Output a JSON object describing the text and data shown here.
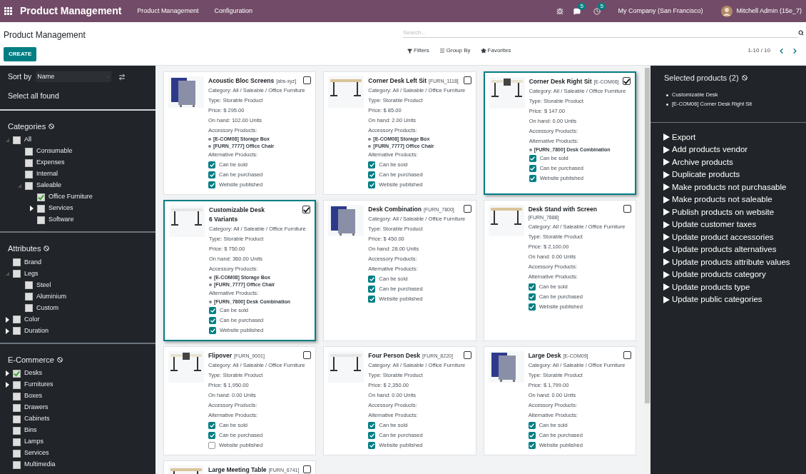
{
  "navbar": {
    "app_title": "Product Management",
    "menus": [
      "Product Management",
      "Configuration"
    ],
    "messages_badge": "5",
    "activities_badge": "5",
    "company": "My Company (San Francisco)",
    "user": "Mitchell Admin (15e_7)"
  },
  "control_panel": {
    "breadcrumb": "Product Management",
    "search": {
      "placeholder": "Search..."
    },
    "create_button": "CREATE",
    "filters": [
      {
        "kind": "filter",
        "label": "Filters"
      },
      {
        "kind": "group",
        "label": "Group By"
      },
      {
        "kind": "favorite",
        "label": "Favorites"
      }
    ],
    "pager": "1-10 / 10"
  },
  "sidebar": {
    "sort_label": "Sort by",
    "sort_value": "Name",
    "select_all": "Select all found",
    "sections": [
      {
        "title": "Categories",
        "items": [
          {
            "label": "All",
            "checked": false,
            "expanded": true,
            "children": [
              {
                "label": "Consumable",
                "checked": false
              },
              {
                "label": "Expenses",
                "checked": false
              },
              {
                "label": "Internal",
                "checked": false
              },
              {
                "label": "Saleable",
                "checked": false,
                "expanded": true,
                "children": [
                  {
                    "label": "Office Furniture",
                    "checked": true
                  },
                  {
                    "label": "Services",
                    "checked": false,
                    "expanded": false
                  },
                  {
                    "label": "Software",
                    "checked": false
                  }
                ]
              }
            ]
          }
        ]
      },
      {
        "title": "Attributes",
        "items": [
          {
            "label": "Brand",
            "checked": false
          },
          {
            "label": "Legs",
            "checked": false,
            "expanded": true,
            "children": [
              {
                "label": "Steel",
                "checked": false
              },
              {
                "label": "Aluminium",
                "checked": false
              },
              {
                "label": "Custom",
                "checked": false
              }
            ]
          },
          {
            "label": "Color",
            "checked": false,
            "expanded": false
          },
          {
            "label": "Duration",
            "checked": false,
            "expanded": false
          }
        ]
      },
      {
        "title": "E-Commerce",
        "items": [
          {
            "label": "Desks",
            "checked": true,
            "expanded": false
          },
          {
            "label": "Furnitures",
            "checked": false,
            "expanded": false
          },
          {
            "label": "Boxes",
            "checked": false
          },
          {
            "label": "Drawers",
            "checked": false
          },
          {
            "label": "Cabinets",
            "checked": false
          },
          {
            "label": "Bins",
            "checked": false
          },
          {
            "label": "Lamps",
            "checked": false
          },
          {
            "label": "Services",
            "checked": false
          },
          {
            "label": "Multimedia",
            "checked": false
          }
        ]
      }
    ]
  },
  "cards": [
    {
      "name": "Acoustic Bloc Screens",
      "code": "[abs-xyz]",
      "selected": false,
      "category": "Category: All / Saleable / Office Furniture",
      "type": "Type: Storable Product",
      "price": "Price: $ 295.00",
      "on_hand": "On hand: 102.00 Units",
      "accessories_label": "Accessory Products:",
      "accessories": [
        "[E-COM08] Storage Box",
        "[FURN_7777] Office Chair"
      ],
      "alternatives_label": "Alternative Products:",
      "flags": [
        {
          "label": "Can be sold",
          "checked": true
        },
        {
          "label": "Can be purchased",
          "checked": true
        },
        {
          "label": "Website published",
          "checked": true
        }
      ]
    },
    {
      "name": "Corner Desk Left Sit",
      "code": "[FURN_1118]",
      "selected": false,
      "category": "Category: All / Saleable / Office Furniture",
      "type": "Type: Storable Product",
      "price": "Price: $ 85.00",
      "on_hand": "On hand: 2.00 Units",
      "accessories_label": "Accessory Products:",
      "accessories": [
        "[E-COM08] Storage Box",
        "[FURN_7777] Office Chair"
      ],
      "alternatives_label": "Alternative Products:",
      "flags": [
        {
          "label": "Can be sold",
          "checked": true
        },
        {
          "label": "Can be purchased",
          "checked": true
        },
        {
          "label": "Website published",
          "checked": true
        }
      ]
    },
    {
      "name": "Corner Desk Right Sit",
      "code": "[E-COM06]",
      "selected": true,
      "category": "Category: All / Saleable / Office Furniture",
      "type": "Type: Storable Product",
      "price": "Price: $ 147.00",
      "on_hand": "On hand: 0.00 Units",
      "accessories_label": "Accessory Products:",
      "alternatives_label": "Alternative Products:",
      "alternatives": [
        "[FURN_7800] Desk Combination"
      ],
      "flags": [
        {
          "label": "Can be sold",
          "checked": true
        },
        {
          "label": "Can be purchased",
          "checked": true
        },
        {
          "label": "Website published",
          "checked": true
        }
      ]
    },
    {
      "name": "Customizable Desk",
      "variants": "6 Variants",
      "selected": true,
      "category": "Category: All / Saleable / Office Furniture",
      "type": "Type: Storable Product",
      "price": "Price: $ 750.00",
      "on_hand": "On hand: 360.00 Units",
      "accessories_label": "Accessory Products:",
      "accessories": [
        "[E-COM08] Storage Box",
        "[FURN_7777] Office Chair"
      ],
      "alternatives_label": "Alternative Products:",
      "alternatives": [
        "[FURN_7800] Desk Combination"
      ],
      "flags": [
        {
          "label": "Can be sold",
          "checked": true
        },
        {
          "label": "Can be purchased",
          "checked": true
        },
        {
          "label": "Website published",
          "checked": true
        }
      ]
    },
    {
      "name": "Desk Combination",
      "code": "[FURN_7800]",
      "selected": false,
      "category": "Category: All / Saleable / Office Furniture",
      "type": "Type: Storable Product",
      "price": "Price: $ 450.00",
      "on_hand": "On hand: 28.00 Units",
      "accessories_label": "Accessory Products:",
      "alternatives_label": "Alternative Products:",
      "flags": [
        {
          "label": "Can be sold",
          "checked": true
        },
        {
          "label": "Can be purchased",
          "checked": true
        },
        {
          "label": "Website published",
          "checked": true
        }
      ]
    },
    {
      "name": "Desk Stand with Screen",
      "code": "[FURN_7888]",
      "selected": false,
      "category": "Category: All / Saleable / Office Furniture",
      "type": "Type: Storable Product",
      "price": "Price: $ 2,100.00",
      "on_hand": "On hand: 0.00 Units",
      "accessories_label": "Accessory Products:",
      "alternatives_label": "Alternative Products:",
      "flags": [
        {
          "label": "Can be sold",
          "checked": true
        },
        {
          "label": "Can be purchased",
          "checked": true
        },
        {
          "label": "Website published",
          "checked": true
        }
      ]
    },
    {
      "name": "Flipover",
      "code": "[FURN_9001]",
      "selected": false,
      "category": "Category: All / Saleable / Office Furniture",
      "type": "Type: Storable Product",
      "price": "Price: $ 1,950.00",
      "on_hand": "On hand: 0.00 Units",
      "accessories_label": "Accessory Products:",
      "alternatives_label": "Alternative Products:",
      "flags": [
        {
          "label": "Can be sold",
          "checked": true
        },
        {
          "label": "Can be purchased",
          "checked": true
        },
        {
          "label": "Website published",
          "checked": false
        }
      ]
    },
    {
      "name": "Four Person Desk",
      "code": "[FURN_8220]",
      "selected": false,
      "category": "Category: All / Saleable / Office Furniture",
      "type": "Type: Storable Product",
      "price": "Price: $ 2,350.00",
      "on_hand": "On hand: 0.00 Units",
      "accessories_label": "Accessory Products:",
      "alternatives_label": "Alternative Products:",
      "flags": [
        {
          "label": "Can be sold",
          "checked": true
        },
        {
          "label": "Can be purchased",
          "checked": true
        },
        {
          "label": "Website published",
          "checked": true
        }
      ]
    },
    {
      "name": "Large Desk",
      "code": "[E-COM09]",
      "selected": false,
      "category": "Category: All / Saleable / Office Furniture",
      "type": "Type: Storable Product",
      "price": "Price: $ 1,799.00",
      "on_hand": "On hand: 0.00 Units",
      "accessories_label": "Accessory Products:",
      "alternatives_label": "Alternative Products:",
      "flags": [
        {
          "label": "Can be sold",
          "checked": true
        },
        {
          "label": "Can be purchased",
          "checked": true
        },
        {
          "label": "Website published",
          "checked": true
        }
      ]
    },
    {
      "name": "Large Meeting Table",
      "code": "[FURN_6741]",
      "selected": false
    }
  ],
  "selection_panel": {
    "title": "Selected products (2)",
    "selected": [
      "Customizable Desk",
      "[E-COM06] Corner Desk Right Sit"
    ],
    "actions": [
      "Export",
      "Add products vendor",
      "Archive products",
      "Duplicate products",
      "Make products not purchasable",
      "Make products not saleable",
      "Publish products on website",
      "Update customer taxes",
      "Update product accessories",
      "Update products alternatives",
      "Update products attribute values",
      "Update products category",
      "Update products type",
      "Update public categories"
    ]
  }
}
